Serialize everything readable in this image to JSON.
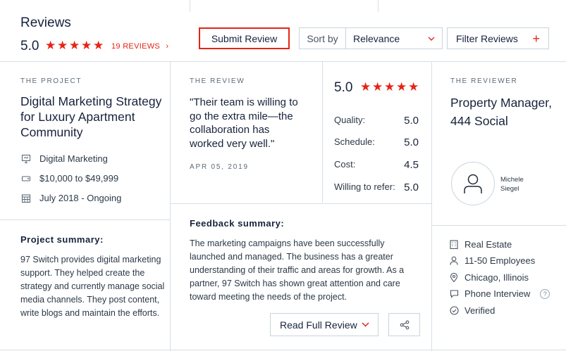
{
  "header": {
    "title": "Reviews",
    "rating": "5.0",
    "reviews_link": "19 REVIEWS",
    "submit_label": "Submit Review",
    "sort_label": "Sort by",
    "sort_value": "Relevance",
    "filter_label": "Filter Reviews"
  },
  "project": {
    "section_label": "THE PROJECT",
    "title": "Digital Marketing Strategy for Luxury Apartment Community",
    "service": "Digital Marketing",
    "budget": "$10,000 to $49,999",
    "timeline": "July 2018 - Ongoing",
    "summary_label": "Project summary:",
    "summary_text": "97 Switch provides digital marketing support. They helped create the strategy and currently manage social media channels. They post content, write blogs and maintain the efforts."
  },
  "review": {
    "section_label": "THE REVIEW",
    "quote": "\"Their team is willing to go the extra mile—the collaboration has worked very well.\"",
    "date": "APR 05, 2019",
    "overall": "5.0",
    "scores": [
      {
        "label": "Quality:",
        "value": "5.0"
      },
      {
        "label": "Schedule:",
        "value": "5.0"
      },
      {
        "label": "Cost:",
        "value": "4.5"
      },
      {
        "label": "Willing to refer:",
        "value": "5.0"
      }
    ],
    "feedback_label": "Feedback summary:",
    "feedback_text": "The marketing campaigns have been successfully launched and managed. The business has a greater understanding of their traffic and areas for growth. As a partner, 97 Switch has shown great attention and care toward meeting the needs of the project.",
    "read_full_label": "Read Full Review"
  },
  "reviewer": {
    "section_label": "THE REVIEWER",
    "title": "Property Manager, 444 Social",
    "name_first": "Michele",
    "name_last": "Siegel",
    "industry": "Real Estate",
    "size": "11-50 Employees",
    "location": "Chicago, Illinois",
    "interview": "Phone Interview",
    "verified": "Verified",
    "help_mark": "?"
  },
  "colors": {
    "accent": "#e62415",
    "text": "#17233c",
    "border": "#d6dfe6"
  }
}
